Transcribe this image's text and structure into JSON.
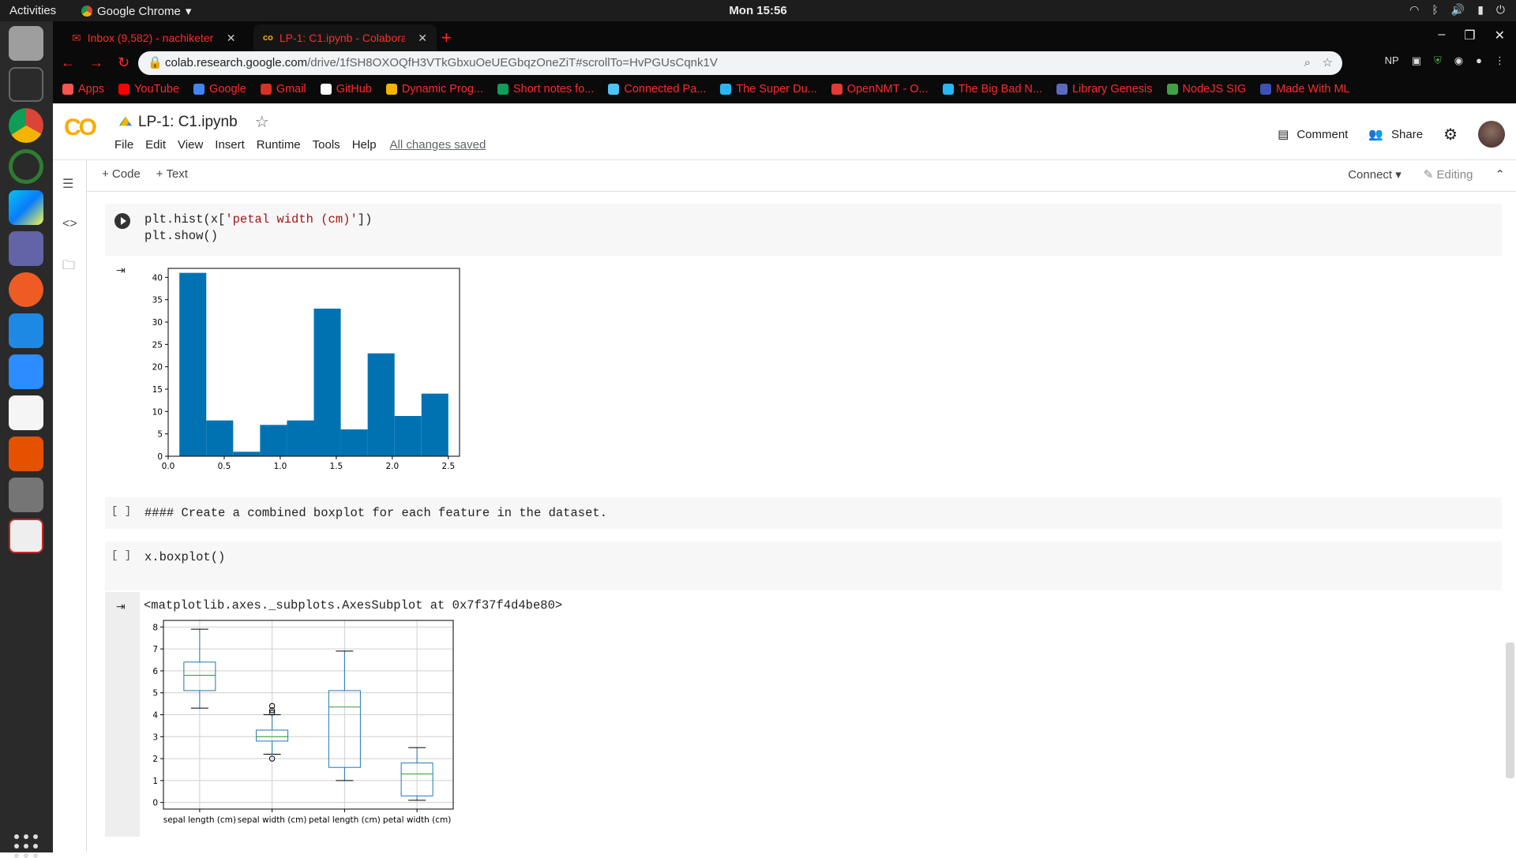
{
  "os": {
    "activities": "Activities",
    "app_name": "Google Chrome",
    "clock": "Mon 15:56"
  },
  "browser": {
    "tabs": [
      {
        "label": "Inbox (9,582) - nachiketer"
      },
      {
        "label": "LP-1: C1.ipynb - Colaborat"
      }
    ],
    "url_host": "colab.research.google.com",
    "url_path": "/drive/1fSH8OXOQfH3VTkGbxuOeUEGbqzOneZiT#scrollTo=HvPGUsCqnk1V",
    "ext_np": "NP",
    "bookmarks": [
      {
        "label": "Apps",
        "color": "#ff5252"
      },
      {
        "label": "YouTube",
        "color": "#ff0000"
      },
      {
        "label": "Google",
        "color": "#4285f4"
      },
      {
        "label": "Gmail",
        "color": "#d93025"
      },
      {
        "label": "GitHub",
        "color": "#ffffff"
      },
      {
        "label": "Dynamic Prog...",
        "color": "#f4b400"
      },
      {
        "label": "Short notes fo...",
        "color": "#0f9d58"
      },
      {
        "label": "Connected Pa...",
        "color": "#4fc3f7"
      },
      {
        "label": "The Super Du...",
        "color": "#29b6f6"
      },
      {
        "label": "OpenNMT - O...",
        "color": "#e53935"
      },
      {
        "label": "The Big Bad N...",
        "color": "#29b6f6"
      },
      {
        "label": "Library Genesis",
        "color": "#5c6bc0"
      },
      {
        "label": "NodeJS SIG",
        "color": "#43a047"
      },
      {
        "label": "Made With ML",
        "color": "#3f51b5"
      }
    ]
  },
  "colab": {
    "title": "LP-1: C1.ipynb",
    "menus": [
      "File",
      "Edit",
      "View",
      "Insert",
      "Runtime",
      "Tools",
      "Help"
    ],
    "saved_status": "All changes saved",
    "comment_label": "Comment",
    "share_label": "Share",
    "add_code": "+ Code",
    "add_text": "+ Text",
    "connect_label": "Connect",
    "editing_label": "Editing"
  },
  "cells": {
    "hist_code_line1_a": "plt.hist(x[",
    "hist_code_line1_str": "'petal width (cm)'",
    "hist_code_line1_b": "])",
    "hist_code_line2": "plt.show()",
    "comment_cell_prompt": "[ ]",
    "comment_cell_text": "#### Create a combined boxplot for each feature in the dataset.",
    "boxplot_prompt": "[ ]",
    "boxplot_code": "x.boxplot()",
    "boxplot_output_text": "<matplotlib.axes._subplots.AxesSubplot at 0x7f37f4d4be80>"
  },
  "chart_data": [
    {
      "type": "bar",
      "title": "",
      "xlabel": "",
      "ylabel": "",
      "bin_edges": [
        0.1,
        0.34,
        0.58,
        0.82,
        1.06,
        1.3,
        1.54,
        1.78,
        2.02,
        2.26,
        2.5
      ],
      "values": [
        41,
        8,
        1,
        7,
        8,
        33,
        6,
        23,
        9,
        14
      ],
      "xlim": [
        0.0,
        2.6
      ],
      "ylim": [
        0,
        42
      ],
      "xticks": [
        "0.0",
        "0.5",
        "1.0",
        "1.5",
        "2.0",
        "2.5"
      ],
      "yticks": [
        "0",
        "5",
        "10",
        "15",
        "20",
        "25",
        "30",
        "35",
        "40"
      ],
      "color": "#0072b2"
    },
    {
      "type": "box",
      "title": "",
      "categories": [
        "sepal length (cm)",
        "sepal width (cm)",
        "petal length (cm)",
        "petal width (cm)"
      ],
      "boxes": [
        {
          "whisker_low": 4.3,
          "q1": 5.1,
          "median": 5.8,
          "q3": 6.4,
          "whisker_high": 7.9,
          "outliers": []
        },
        {
          "whisker_low": 2.2,
          "q1": 2.8,
          "median": 3.0,
          "q3": 3.3,
          "whisker_high": 4.0,
          "outliers": [
            2.0,
            4.1,
            4.2,
            4.4
          ]
        },
        {
          "whisker_low": 1.0,
          "q1": 1.6,
          "median": 4.35,
          "q3": 5.1,
          "whisker_high": 6.9,
          "outliers": []
        },
        {
          "whisker_low": 0.1,
          "q1": 0.3,
          "median": 1.3,
          "q3": 1.8,
          "whisker_high": 2.5,
          "outliers": []
        }
      ],
      "ylim": [
        -0.3,
        8.3
      ],
      "yticks": [
        "0",
        "1",
        "2",
        "3",
        "4",
        "5",
        "6",
        "7",
        "8"
      ],
      "grid": true,
      "box_color": "#1f77b4",
      "median_color": "#2ca02c"
    }
  ]
}
